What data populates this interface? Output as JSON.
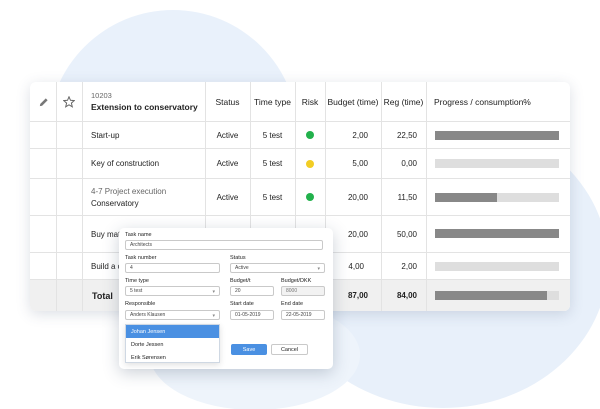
{
  "table": {
    "header": {
      "project_number": "10203",
      "project_name": "Extension to conservatory",
      "columns": {
        "status": "Status",
        "time_type": "Time type",
        "risk": "Risk",
        "budget": "Budget (time)",
        "reg": "Reg (time)",
        "progress": "Progress / consumption%"
      }
    },
    "rows": [
      {
        "name": "Start-up",
        "status": "Active",
        "time_type": "5 test",
        "risk": "#22b14c",
        "budget": "2,00",
        "reg": "22,50",
        "progress": 1.0
      },
      {
        "name": "Key of construction",
        "status": "Active",
        "time_type": "5 test",
        "risk": "#f2cd24",
        "budget": "5,00",
        "reg": "0,00",
        "progress": 0.0
      },
      {
        "sub": "4-7 Project execution",
        "name": "Conservatory",
        "status": "Active",
        "time_type": "5 test",
        "risk": "#22b14c",
        "budget": "20,00",
        "reg": "11,50",
        "progress": 0.5
      },
      {
        "name": "Buy mate",
        "budget": "20,00",
        "reg": "50,00",
        "progress": 1.0
      },
      {
        "name": "Build a c",
        "budget": "4,00",
        "reg": "2,00",
        "progress": 0.0
      }
    ],
    "total": {
      "label": "Total",
      "budget": "87,00",
      "reg": "84,00",
      "progress": 0.9
    }
  },
  "dialog": {
    "task_name_label": "Task name",
    "task_name_value": "Architects",
    "task_number_label": "Task number",
    "task_number_value": "4",
    "status_label": "Status",
    "status_value": "Active",
    "time_type_label": "Time type",
    "time_type_value": "5 test",
    "budget_t_label": "Budget/t",
    "budget_t_value": "20",
    "budget_dkk_label": "Budget/DKK",
    "budget_dkk_value": "8000",
    "responsible_label": "Responsible",
    "responsible_value": "Anders Klausen",
    "responsible_options": [
      "Johan Jensen",
      "Dorte Jessen",
      "Erik Sørensen"
    ],
    "start_date_label": "Start date",
    "start_date_value": "01-05-2019",
    "end_date_label": "End date",
    "end_date_value": "22-05-2019",
    "save_label": "Save",
    "cancel_label": "Cancel"
  },
  "colors": {
    "accent": "#4a90e2",
    "risk_green": "#22b14c",
    "risk_yellow": "#f2cd24",
    "bar_fill": "#888888",
    "bar_track": "#dedede"
  }
}
